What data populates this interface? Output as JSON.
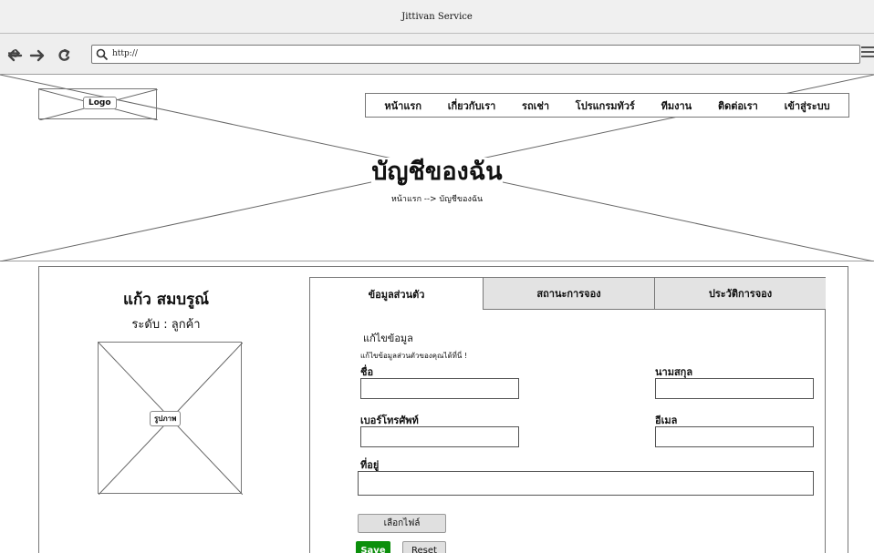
{
  "window": {
    "title": "Jittivan Service"
  },
  "browser": {
    "url": "http://",
    "icons": [
      "back-arrow-icon",
      "forward-arrow-icon",
      "reload-icon",
      "search-icon",
      "menu-icon"
    ]
  },
  "header": {
    "logo": "Logo",
    "nav": [
      "หน้าแรก",
      "เกี่ยวกับเรา",
      "รถเช่า",
      "โปรแกรมทัวร์",
      "ทีมงาน",
      "ติดต่อเรา",
      "เข้าสู่ระบบ"
    ],
    "page_title": "บัญชีของฉัน",
    "breadcrumb": "หน้าแรก --> บัญชีของฉัน"
  },
  "profile": {
    "name": "แก้ว สมบรูณ์",
    "level": "ระดับ : ลูกค้า",
    "photo_label": "รูปภาพ"
  },
  "tabs": [
    "ข้อมูลส่วนตัว",
    "สถานะการจอง",
    "ประวัติการจอง"
  ],
  "form": {
    "title": "แก้ไขข้อมูล",
    "subtitle": "แก้ไขข้อมูลส่วนตัวของคุณได้ที่นี่ !",
    "first_name_label": "ชื่อ",
    "last_name_label": "นามสกุล",
    "phone_label": "เบอร์โทรศัพท์",
    "email_label": "อีเมล",
    "address_label": "ที่อยู่",
    "file_button": "เลือกไฟล์",
    "save_button": "Save",
    "reset_button": "Reset"
  },
  "colors": {
    "save": "#0b8f0b",
    "chrome": "#f0f0f0",
    "tab_inactive": "#e3e3e3"
  }
}
